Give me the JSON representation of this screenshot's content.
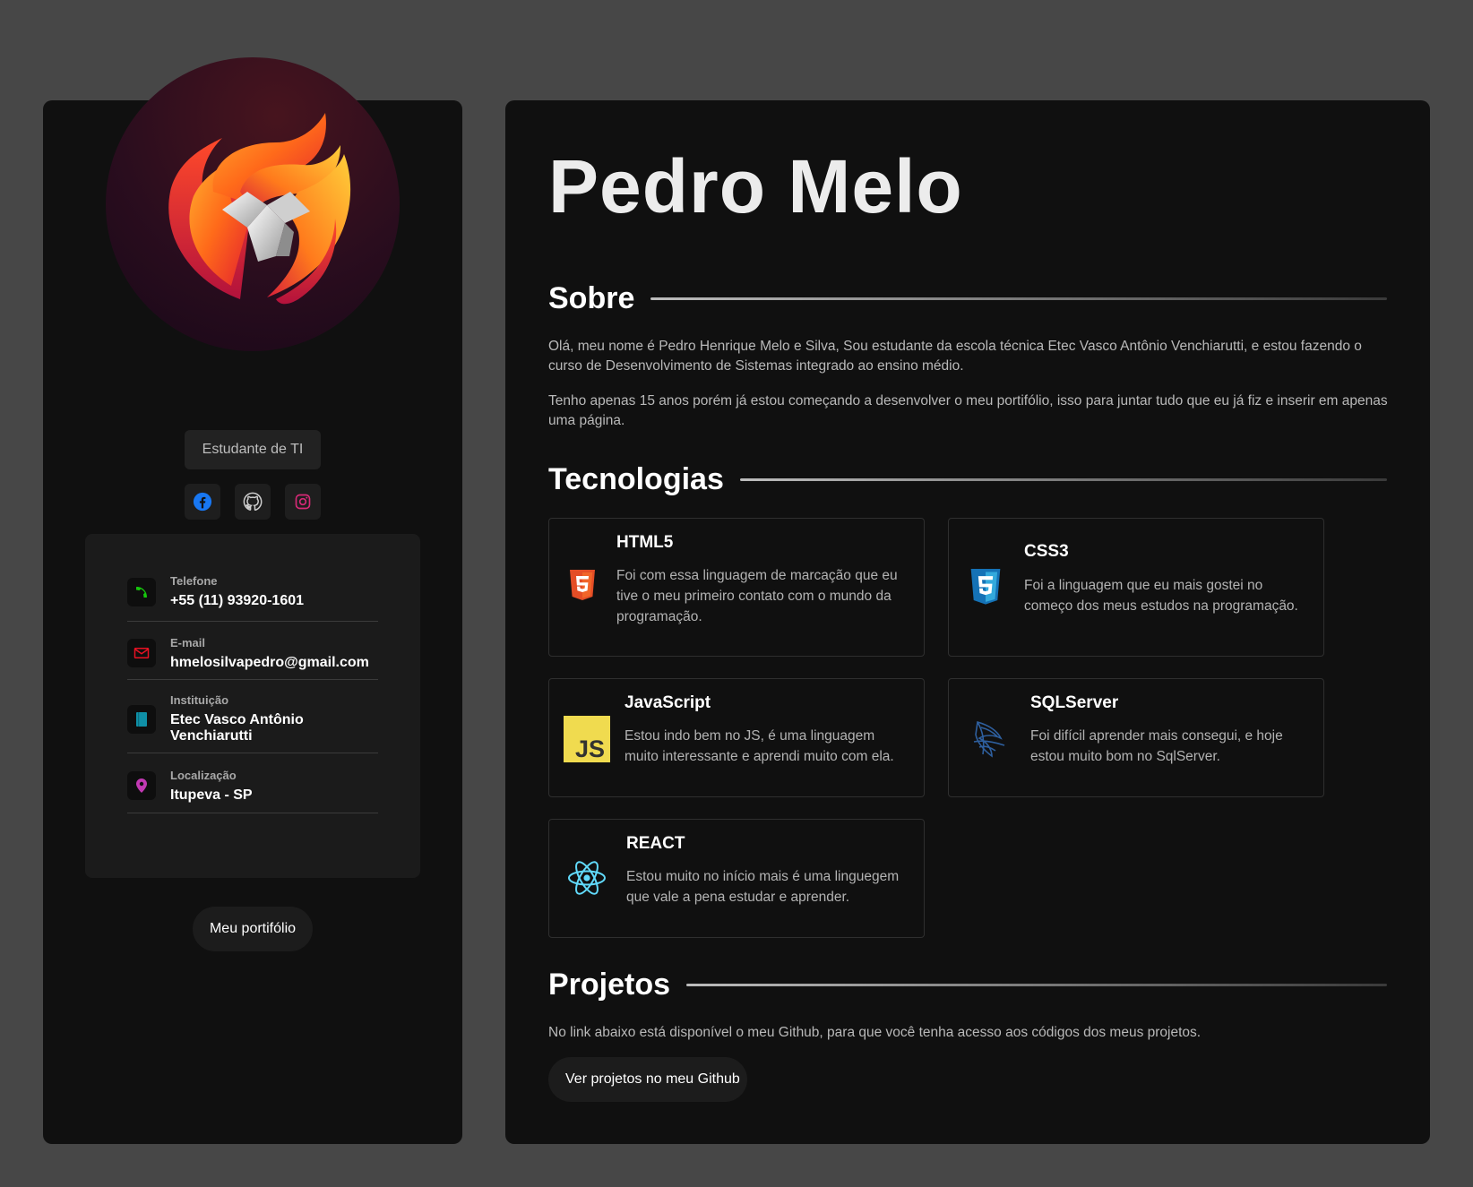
{
  "profile": {
    "role": "Estudante de TI",
    "avatar_icon": "flame-lion-logo-icon",
    "socials": [
      {
        "name": "facebook",
        "icon": "facebook-icon",
        "color": "#1877f2"
      },
      {
        "name": "github",
        "icon": "github-icon",
        "color": "#d0d0d0"
      },
      {
        "name": "instagram",
        "icon": "instagram-icon",
        "color": "#d62976"
      }
    ],
    "portfolio_label": "Meu portifólio"
  },
  "contacts": [
    {
      "label": "Telefone",
      "value": "+55 (11) 93920-1601",
      "icon": "phone-icon",
      "color": "#16c60c"
    },
    {
      "label": "E-mail",
      "value": "hmelosilvapedro@gmail.com",
      "icon": "mail-icon",
      "color": "#e81123"
    },
    {
      "label": "Instituição",
      "value": "Etec Vasco Antônio Venchiarutti",
      "icon": "book-icon",
      "color": "#0f8fa6"
    },
    {
      "label": "Localização",
      "value": "Itupeva - SP",
      "icon": "location-pin-icon",
      "color": "#c239b3"
    }
  ],
  "main": {
    "name": "Pedro Melo",
    "about": {
      "title": "Sobre",
      "paragraphs": [
        "Olá, meu nome é Pedro Henrique Melo e Silva, Sou estudante da escola técnica Etec Vasco Antônio Venchiarutti, e estou fazendo o curso de Desenvolvimento de Sistemas integrado ao ensino médio.",
        "Tenho apenas 15 anos porém já estou começando a desenvolver o meu portifólio, isso para juntar tudo que eu já fiz e inserir em apenas uma página."
      ]
    },
    "technologies": {
      "title": "Tecnologias",
      "items": [
        {
          "name": "HTML5",
          "icon": "html5-icon",
          "description": "Foi com essa linguagem de marcação que eu tive o meu primeiro contato com o mundo da programação."
        },
        {
          "name": "CSS3",
          "icon": "css3-icon",
          "description": "Foi a linguagem que eu mais gostei no começo dos meus estudos na programação."
        },
        {
          "name": "JavaScript",
          "icon": "javascript-icon",
          "description": "Estou indo bem no JS, é uma linguagem muito interessante e aprendi muito com ela."
        },
        {
          "name": "SQLServer",
          "icon": "sqlserver-icon",
          "description": "Foi difícil aprender mais consegui, e hoje estou muito bom no SqlServer."
        },
        {
          "name": "REACT",
          "icon": "react-icon",
          "description": "Estou muito no início mais é uma linguegem que vale a pena estudar e aprender."
        }
      ]
    },
    "projects": {
      "title": "Projetos",
      "text": "No link abaixo está disponível o meu Github, para que você tenha acesso aos códigos dos meus projetos.",
      "button_label": "Ver projetos no meu Github"
    }
  },
  "colors": {
    "page_bg": "#474747",
    "panel_bg": "#101010",
    "contact_panel_bg": "#1b1b1b",
    "html5": "#e44d26",
    "css3": "#1572b6",
    "javascript": "#f0db4f",
    "react": "#61dafb",
    "sqlserver": "#2e5f9e"
  }
}
